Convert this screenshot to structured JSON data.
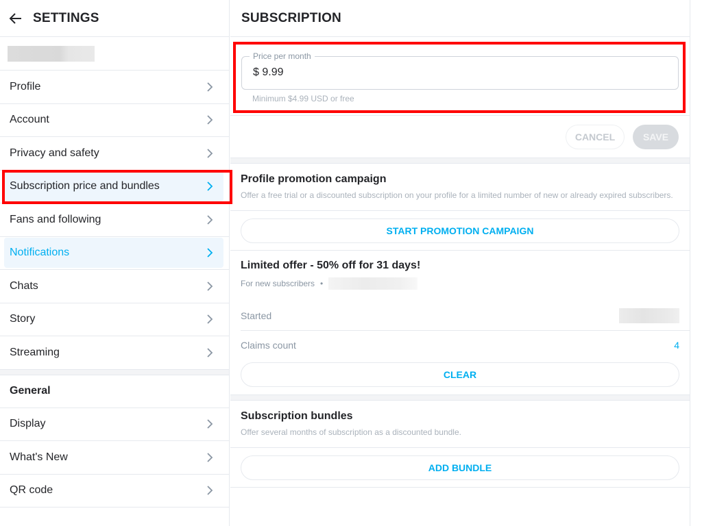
{
  "sidebar": {
    "title": "SETTINGS",
    "back_icon": "arrow-left-icon",
    "items": [
      {
        "label": "Profile"
      },
      {
        "label": "Account"
      },
      {
        "label": "Privacy and safety"
      },
      {
        "label": "Subscription price and bundles"
      },
      {
        "label": "Fans and following"
      },
      {
        "label": "Notifications"
      },
      {
        "label": "Chats"
      },
      {
        "label": "Story"
      },
      {
        "label": "Streaming"
      }
    ],
    "general_title": "General",
    "general_items": [
      {
        "label": "Display"
      },
      {
        "label": "What's New"
      },
      {
        "label": "QR code"
      }
    ]
  },
  "main": {
    "title": "SUBSCRIPTION",
    "price": {
      "legend": "Price per month",
      "value": "$ 9.99",
      "hint": "Minimum $4.99 USD or free"
    },
    "cancel_label": "CANCEL",
    "save_label": "SAVE",
    "promotion": {
      "title": "Profile promotion campaign",
      "description": "Offer a free trial or a discounted subscription on your profile for a limited number of new or already expired subscribers.",
      "button": "START PROMOTION CAMPAIGN"
    },
    "offer": {
      "title": "Limited offer - 50% off for 31 days!",
      "audience": "For new subscribers",
      "separator": "•",
      "started_label": "Started",
      "claims_label": "Claims count",
      "claims_value": "4",
      "clear_button": "CLEAR"
    },
    "bundles": {
      "title": "Subscription bundles",
      "description": "Offer several months of subscription as a discounted bundle.",
      "button": "ADD BUNDLE"
    }
  },
  "colors": {
    "accent": "#00aff0",
    "highlight": "#ff0000",
    "active_bg": "#eef6fd"
  }
}
